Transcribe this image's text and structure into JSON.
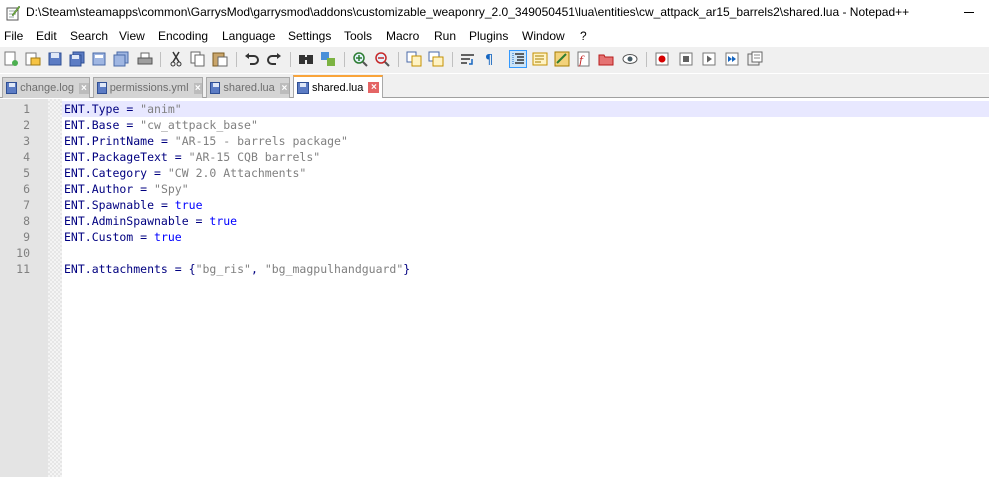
{
  "window": {
    "title": "D:\\Steam\\steamapps\\common\\GarrysMod\\garrysmod\\addons\\customizable_weaponry_2.0_349050451\\lua\\entities\\cw_attpack_ar15_barrels2\\shared.lua - Notepad++",
    "icon": "notepad-plus-plus-icon"
  },
  "menu": [
    "File",
    "Edit",
    "Search",
    "View",
    "Encoding",
    "Language",
    "Settings",
    "Tools",
    "Macro",
    "Run",
    "Plugins",
    "Window",
    "?"
  ],
  "toolbar": [
    "new-file-icon",
    "open-file-icon",
    "save-icon",
    "save-all-icon",
    "close-icon",
    "close-all-icon",
    "print-icon",
    "cut-icon",
    "copy-icon",
    "paste-icon",
    "undo-icon",
    "redo-icon",
    "find-icon",
    "replace-icon",
    "zoom-in-icon",
    "zoom-out-icon",
    "sync-vertical-icon",
    "sync-horizontal-icon",
    "word-wrap-icon",
    "show-all-characters-icon",
    "indent-guide-icon",
    "user-defined-language-icon",
    "document-map-icon",
    "function-list-icon",
    "folder-as-workspace-icon",
    "monitoring-icon",
    "record-macro-icon",
    "stop-recording-icon",
    "play-macro-icon",
    "run-macro-multiple-icon",
    "save-macro-icon"
  ],
  "tabs": [
    {
      "label": "change.log",
      "active": false
    },
    {
      "label": "permissions.yml",
      "active": false
    },
    {
      "label": "shared.lua",
      "active": false
    },
    {
      "label": "shared.lua",
      "active": true
    }
  ],
  "editor": {
    "line_numbers": [
      "1",
      "2",
      "3",
      "4",
      "5",
      "6",
      "7",
      "8",
      "9",
      "10",
      "11"
    ],
    "lines": [
      [
        {
          "t": "id",
          "v": "ENT.Type"
        },
        {
          "t": "op",
          "v": " = "
        },
        {
          "t": "str",
          "v": "\"anim\""
        }
      ],
      [
        {
          "t": "id",
          "v": "ENT.Base"
        },
        {
          "t": "op",
          "v": " = "
        },
        {
          "t": "str",
          "v": "\"cw_attpack_base\""
        }
      ],
      [
        {
          "t": "id",
          "v": "ENT.PrintName"
        },
        {
          "t": "op",
          "v": " = "
        },
        {
          "t": "str",
          "v": "\"AR-15 - barrels package\""
        }
      ],
      [
        {
          "t": "id",
          "v": "ENT.PackageText"
        },
        {
          "t": "op",
          "v": " = "
        },
        {
          "t": "str",
          "v": "\"AR-15 CQB barrels\""
        }
      ],
      [
        {
          "t": "id",
          "v": "ENT.Category"
        },
        {
          "t": "op",
          "v": " = "
        },
        {
          "t": "str",
          "v": "\"CW 2.0 Attachments\""
        }
      ],
      [
        {
          "t": "id",
          "v": "ENT.Author"
        },
        {
          "t": "op",
          "v": " = "
        },
        {
          "t": "str",
          "v": "\"Spy\""
        }
      ],
      [
        {
          "t": "id",
          "v": "ENT.Spawnable"
        },
        {
          "t": "op",
          "v": " = "
        },
        {
          "t": "kw",
          "v": "true"
        }
      ],
      [
        {
          "t": "id",
          "v": "ENT.AdminSpawnable"
        },
        {
          "t": "op",
          "v": " = "
        },
        {
          "t": "kw",
          "v": "true"
        }
      ],
      [
        {
          "t": "id",
          "v": "ENT.Custom"
        },
        {
          "t": "op",
          "v": " = "
        },
        {
          "t": "kw",
          "v": "true"
        }
      ],
      [],
      [
        {
          "t": "id",
          "v": "ENT.attachments"
        },
        {
          "t": "op",
          "v": " = {"
        },
        {
          "t": "str",
          "v": "\"bg_ris\""
        },
        {
          "t": "op",
          "v": ", "
        },
        {
          "t": "str",
          "v": "\"bg_magpulhandguard\""
        },
        {
          "t": "op",
          "v": "}"
        }
      ]
    ]
  },
  "colors": {
    "string": "#808080",
    "keyword": "#0000ff",
    "identifier": "#000080",
    "active_tab_accent": "#f9a43a",
    "current_line": "#e8e8ff"
  }
}
